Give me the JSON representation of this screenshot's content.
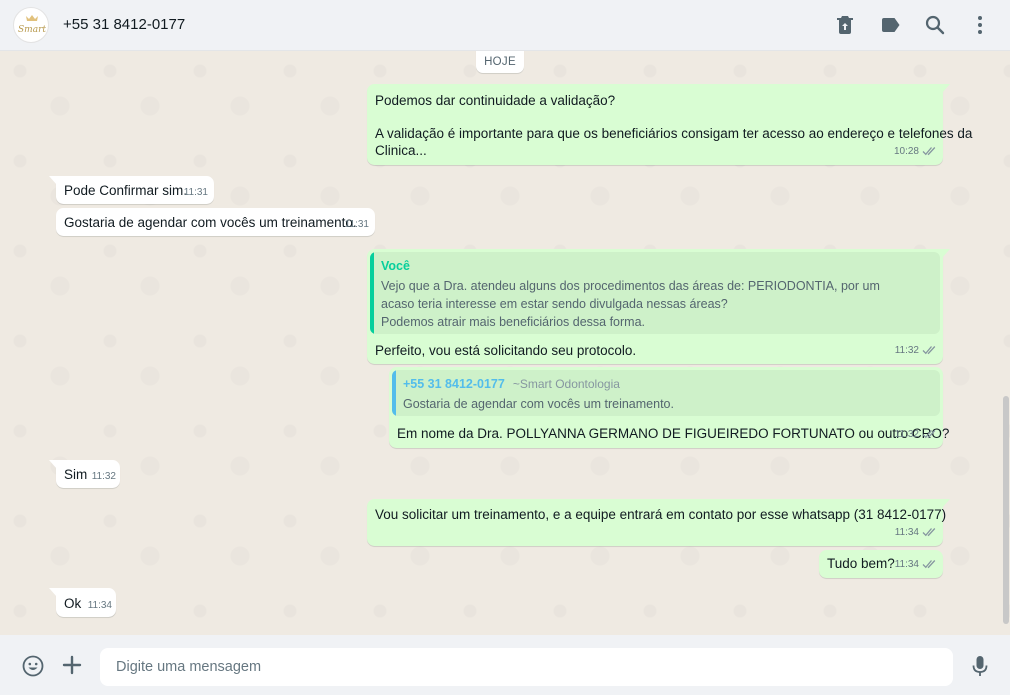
{
  "header": {
    "contact_name": "+55 31 8412-0177",
    "avatar_text": "Smart",
    "icons": [
      "delete-icon",
      "label-icon",
      "search-icon",
      "menu-icon"
    ]
  },
  "chat": {
    "date_label": "HOJE",
    "messages": [
      {
        "dir": "out",
        "lines": [
          "Podemos dar continuidade a validação?",
          "",
          "A validação é importante para que os beneficiários consigam ter acesso ao endereço e telefones da",
          "Clinica..."
        ],
        "time": "10:28"
      },
      {
        "dir": "in",
        "lines": [
          "Pode Confirmar sim."
        ],
        "time": "11:31"
      },
      {
        "dir": "in",
        "lines": [
          "Gostaria de agendar com vocês um treinamento."
        ],
        "time": "11:31"
      },
      {
        "dir": "out",
        "quote": {
          "author": "Você",
          "lines": [
            "Vejo que a Dra. atendeu alguns dos procedimentos das áreas de:   PERIODONTIA, por um",
            "acaso teria interesse em estar sendo divulgada nessas áreas?",
            "Podemos atrair mais beneficiários dessa forma."
          ]
        },
        "lines": [
          "Perfeito, vou está solicitando seu protocolo."
        ],
        "time": "11:32"
      },
      {
        "dir": "out",
        "quote": {
          "author": "+55 31 8412-0177",
          "author_note": "~Smart Odontologia",
          "lines": [
            "Gostaria de agendar com vocês um treinamento."
          ]
        },
        "lines": [
          "Em nome da Dra.  POLLYANNA GERMANO DE FIGUEIREDO FORTUNATO ou outro CRO?"
        ],
        "time": "11:32"
      },
      {
        "dir": "in",
        "lines": [
          "Sim"
        ],
        "time": "11:32"
      },
      {
        "dir": "out",
        "lines": [
          "Vou solicitar um treinamento, e a equipe entrará em contato por esse whatsapp (31 8412-0177)"
        ],
        "time": "11:34"
      },
      {
        "dir": "out",
        "lines": [
          "Tudo bem?"
        ],
        "time": "11:34"
      },
      {
        "dir": "in",
        "lines": [
          "Ok"
        ],
        "time": "11:34"
      }
    ]
  },
  "footer": {
    "input_placeholder": "Digite uma mensagem",
    "icons": [
      "emoji-icon",
      "attach-plus-icon",
      "microphone-icon"
    ]
  },
  "colors": {
    "outgoing_bubble": "#d9fdd3",
    "incoming_bubble": "#ffffff",
    "quote_self": "#06cf9c",
    "quote_other": "#53bdeb",
    "ticks": "#8696a0"
  }
}
